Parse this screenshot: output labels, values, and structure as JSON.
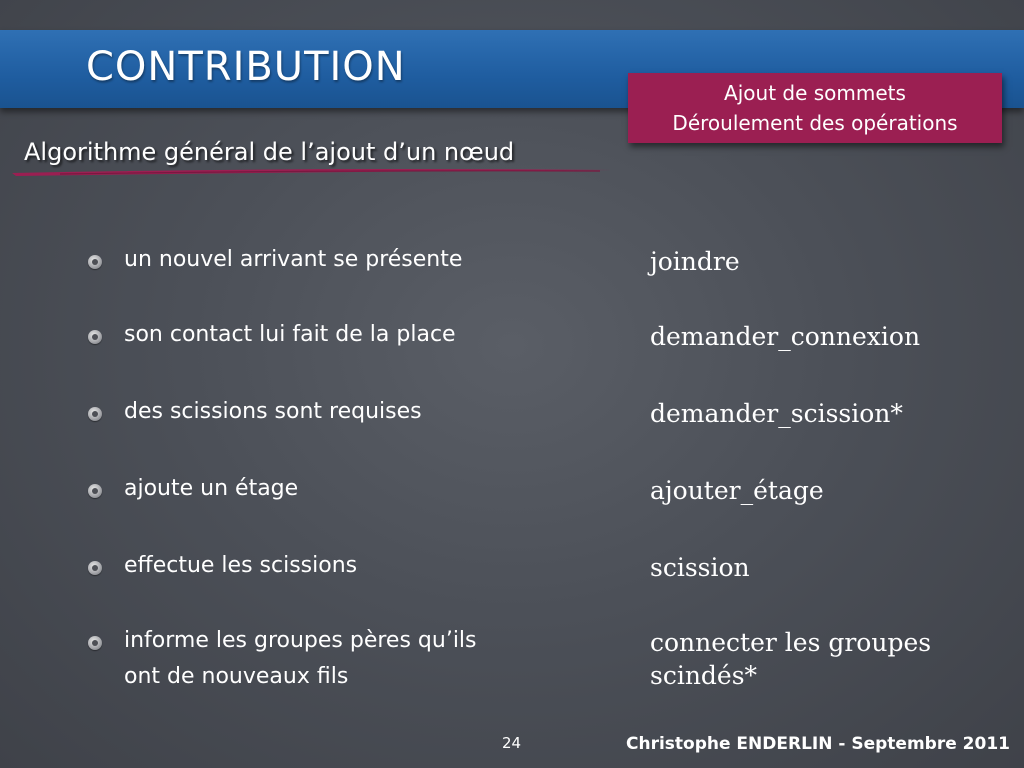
{
  "header": {
    "title": "CONTRIBUTION"
  },
  "section": {
    "line1": "Ajout de sommets",
    "line2": "Déroulement des opérations"
  },
  "subtitle": "Algorithme général de l’ajout d’un nœud",
  "items": [
    {
      "text": "un nouvel arrivant se présente",
      "op": "joindre"
    },
    {
      "text": "son contact lui fait de la place",
      "op": "demander_connexion"
    },
    {
      "text": "des scissions sont requises",
      "op": "demander_scission*"
    },
    {
      "text": "ajoute un étage",
      "op": "ajouter_étage"
    },
    {
      "text": "effectue les scissions",
      "op": "scission"
    },
    {
      "text_line1": "informe les groupes pères qu’ils",
      "text_line2": "ont de nouveaux fils",
      "op_line1": "connecter les groupes",
      "op_line2": "scindés*"
    }
  ],
  "footer": {
    "page_number": "24",
    "author": "Christophe ENDERLIN  - Septembre 2011"
  },
  "colors": {
    "title_bar": "#1f5da0",
    "section_box": "#9b1f52",
    "background": "#4c5058"
  }
}
